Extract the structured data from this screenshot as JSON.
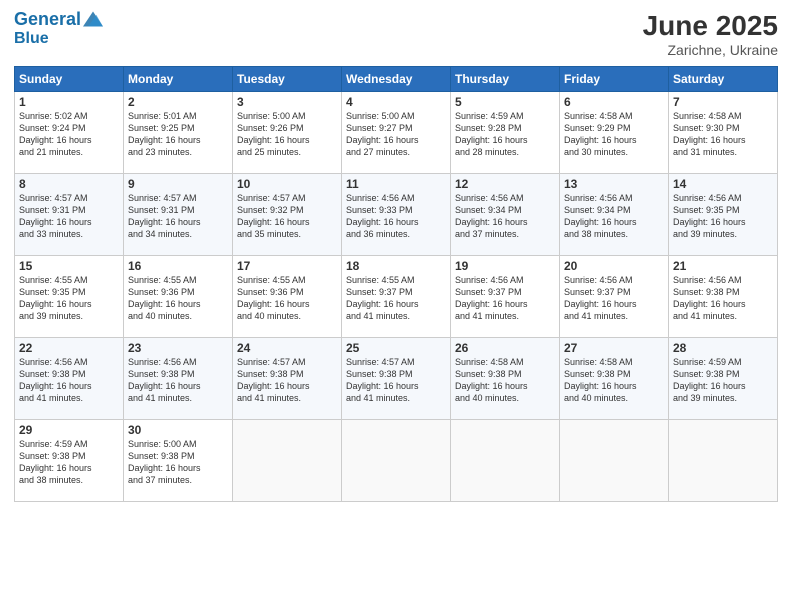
{
  "header": {
    "logo_line1": "General",
    "logo_line2": "Blue",
    "month": "June 2025",
    "location": "Zarichne, Ukraine"
  },
  "weekdays": [
    "Sunday",
    "Monday",
    "Tuesday",
    "Wednesday",
    "Thursday",
    "Friday",
    "Saturday"
  ],
  "weeks": [
    [
      {
        "day": "1",
        "info": "Sunrise: 5:02 AM\nSunset: 9:24 PM\nDaylight: 16 hours\nand 21 minutes."
      },
      {
        "day": "2",
        "info": "Sunrise: 5:01 AM\nSunset: 9:25 PM\nDaylight: 16 hours\nand 23 minutes."
      },
      {
        "day": "3",
        "info": "Sunrise: 5:00 AM\nSunset: 9:26 PM\nDaylight: 16 hours\nand 25 minutes."
      },
      {
        "day": "4",
        "info": "Sunrise: 5:00 AM\nSunset: 9:27 PM\nDaylight: 16 hours\nand 27 minutes."
      },
      {
        "day": "5",
        "info": "Sunrise: 4:59 AM\nSunset: 9:28 PM\nDaylight: 16 hours\nand 28 minutes."
      },
      {
        "day": "6",
        "info": "Sunrise: 4:58 AM\nSunset: 9:29 PM\nDaylight: 16 hours\nand 30 minutes."
      },
      {
        "day": "7",
        "info": "Sunrise: 4:58 AM\nSunset: 9:30 PM\nDaylight: 16 hours\nand 31 minutes."
      }
    ],
    [
      {
        "day": "8",
        "info": "Sunrise: 4:57 AM\nSunset: 9:31 PM\nDaylight: 16 hours\nand 33 minutes."
      },
      {
        "day": "9",
        "info": "Sunrise: 4:57 AM\nSunset: 9:31 PM\nDaylight: 16 hours\nand 34 minutes."
      },
      {
        "day": "10",
        "info": "Sunrise: 4:57 AM\nSunset: 9:32 PM\nDaylight: 16 hours\nand 35 minutes."
      },
      {
        "day": "11",
        "info": "Sunrise: 4:56 AM\nSunset: 9:33 PM\nDaylight: 16 hours\nand 36 minutes."
      },
      {
        "day": "12",
        "info": "Sunrise: 4:56 AM\nSunset: 9:34 PM\nDaylight: 16 hours\nand 37 minutes."
      },
      {
        "day": "13",
        "info": "Sunrise: 4:56 AM\nSunset: 9:34 PM\nDaylight: 16 hours\nand 38 minutes."
      },
      {
        "day": "14",
        "info": "Sunrise: 4:56 AM\nSunset: 9:35 PM\nDaylight: 16 hours\nand 39 minutes."
      }
    ],
    [
      {
        "day": "15",
        "info": "Sunrise: 4:55 AM\nSunset: 9:35 PM\nDaylight: 16 hours\nand 39 minutes."
      },
      {
        "day": "16",
        "info": "Sunrise: 4:55 AM\nSunset: 9:36 PM\nDaylight: 16 hours\nand 40 minutes."
      },
      {
        "day": "17",
        "info": "Sunrise: 4:55 AM\nSunset: 9:36 PM\nDaylight: 16 hours\nand 40 minutes."
      },
      {
        "day": "18",
        "info": "Sunrise: 4:55 AM\nSunset: 9:37 PM\nDaylight: 16 hours\nand 41 minutes."
      },
      {
        "day": "19",
        "info": "Sunrise: 4:56 AM\nSunset: 9:37 PM\nDaylight: 16 hours\nand 41 minutes."
      },
      {
        "day": "20",
        "info": "Sunrise: 4:56 AM\nSunset: 9:37 PM\nDaylight: 16 hours\nand 41 minutes."
      },
      {
        "day": "21",
        "info": "Sunrise: 4:56 AM\nSunset: 9:38 PM\nDaylight: 16 hours\nand 41 minutes."
      }
    ],
    [
      {
        "day": "22",
        "info": "Sunrise: 4:56 AM\nSunset: 9:38 PM\nDaylight: 16 hours\nand 41 minutes."
      },
      {
        "day": "23",
        "info": "Sunrise: 4:56 AM\nSunset: 9:38 PM\nDaylight: 16 hours\nand 41 minutes."
      },
      {
        "day": "24",
        "info": "Sunrise: 4:57 AM\nSunset: 9:38 PM\nDaylight: 16 hours\nand 41 minutes."
      },
      {
        "day": "25",
        "info": "Sunrise: 4:57 AM\nSunset: 9:38 PM\nDaylight: 16 hours\nand 41 minutes."
      },
      {
        "day": "26",
        "info": "Sunrise: 4:58 AM\nSunset: 9:38 PM\nDaylight: 16 hours\nand 40 minutes."
      },
      {
        "day": "27",
        "info": "Sunrise: 4:58 AM\nSunset: 9:38 PM\nDaylight: 16 hours\nand 40 minutes."
      },
      {
        "day": "28",
        "info": "Sunrise: 4:59 AM\nSunset: 9:38 PM\nDaylight: 16 hours\nand 39 minutes."
      }
    ],
    [
      {
        "day": "29",
        "info": "Sunrise: 4:59 AM\nSunset: 9:38 PM\nDaylight: 16 hours\nand 38 minutes."
      },
      {
        "day": "30",
        "info": "Sunrise: 5:00 AM\nSunset: 9:38 PM\nDaylight: 16 hours\nand 37 minutes."
      },
      {
        "day": "",
        "info": ""
      },
      {
        "day": "",
        "info": ""
      },
      {
        "day": "",
        "info": ""
      },
      {
        "day": "",
        "info": ""
      },
      {
        "day": "",
        "info": ""
      }
    ]
  ]
}
